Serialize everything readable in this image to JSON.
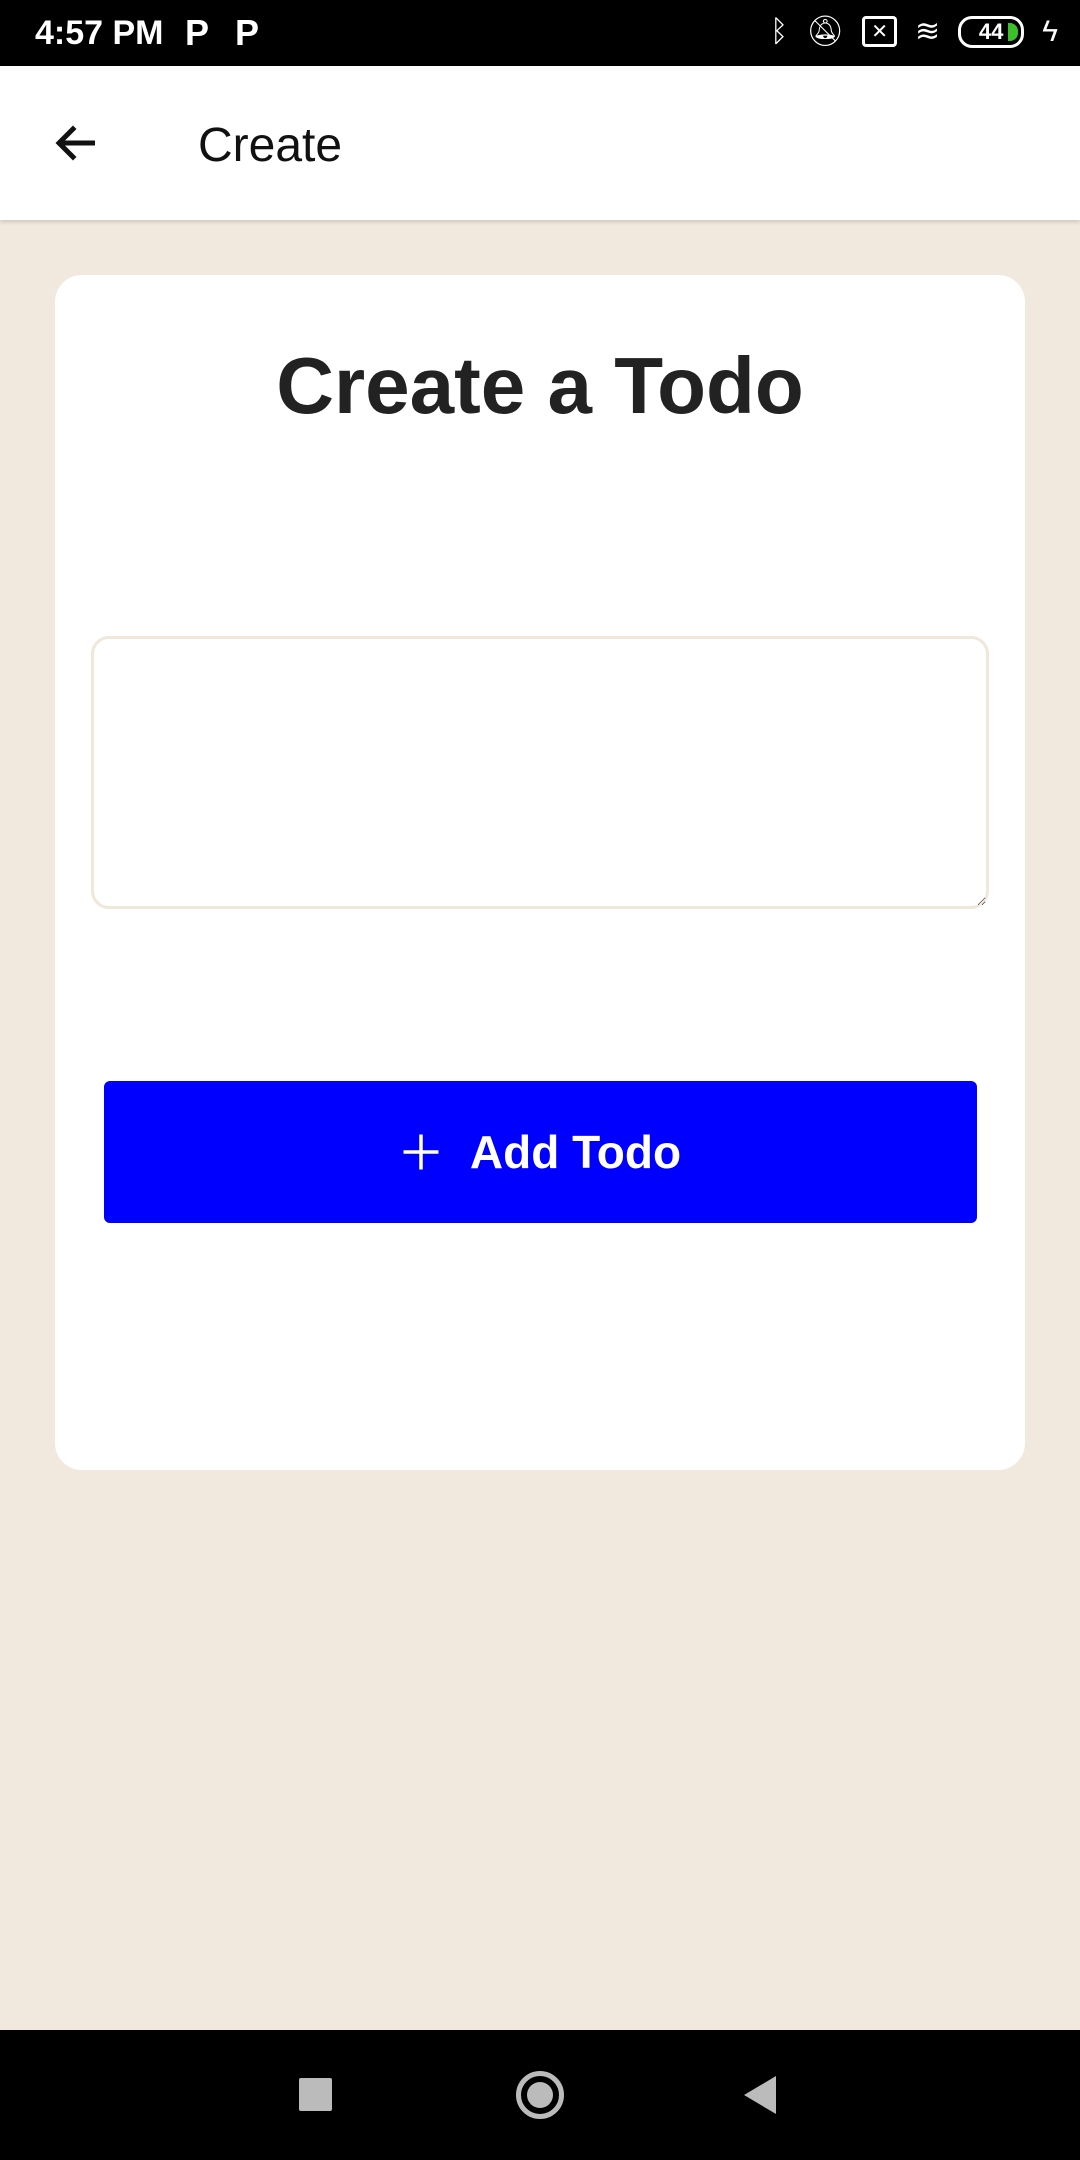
{
  "status_bar": {
    "time": "4:57 PM",
    "notif_icons": [
      "P",
      "P"
    ],
    "battery": "44",
    "colors": {
      "battery_fill": "#3bbf2a"
    }
  },
  "app_bar": {
    "title": "Create",
    "back_icon": "arrow-left-icon"
  },
  "card": {
    "heading": "Create a Todo",
    "input": {
      "value": "",
      "placeholder": ""
    },
    "add_button": {
      "label": "Add Todo",
      "icon": "plus-icon",
      "color": "#0000ff"
    }
  },
  "nav_bar": {
    "icons": [
      "recents-square-icon",
      "home-circle-icon",
      "back-triangle-icon"
    ]
  }
}
